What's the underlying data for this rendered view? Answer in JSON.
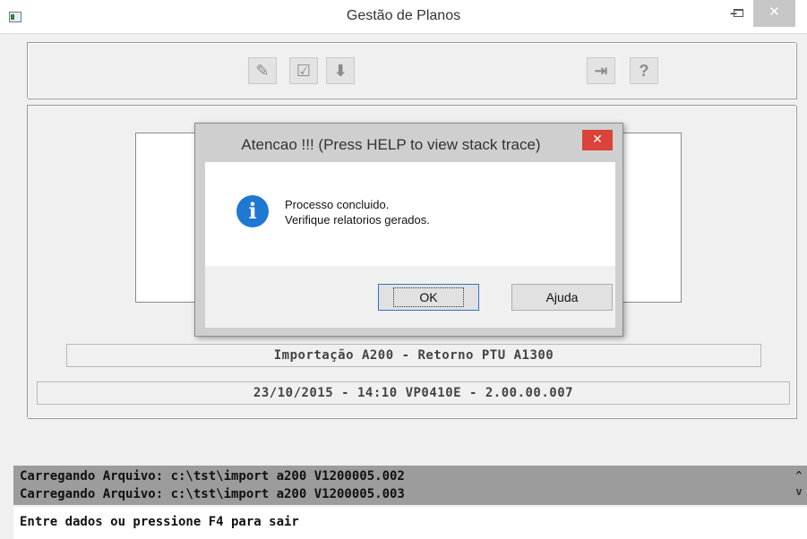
{
  "window": {
    "title": "Gestão de Planos",
    "minimize": "–",
    "close": "✕"
  },
  "toolbar": {
    "icons": [
      "edit-icon",
      "checklist-icon",
      "download-icon",
      "exit-icon",
      "help-icon"
    ]
  },
  "main": {
    "line1": "Importação A200 - Retorno PTU A1300",
    "line2": "23/10/2015 - 14:10  VP0410E - 2.00.00.007"
  },
  "dialog": {
    "title": "Atencao !!! (Press HELP to view stack trace)",
    "close": "✕",
    "icon_letter": "i",
    "message_line1": "Processo concluido.",
    "message_line2": "Verifique relatorios gerados.",
    "ok_label": "OK",
    "help_label": "Ajuda"
  },
  "log": {
    "lines": [
      "Carregando Arquivo: c:\\tst\\import a200 V1200005.002",
      "Carregando Arquivo: c:\\tst\\import a200 V1200005.003"
    ],
    "scroll_up": "^",
    "scroll_down": "v"
  },
  "status": {
    "text": "Entre dados ou pressione F4 para sair"
  }
}
